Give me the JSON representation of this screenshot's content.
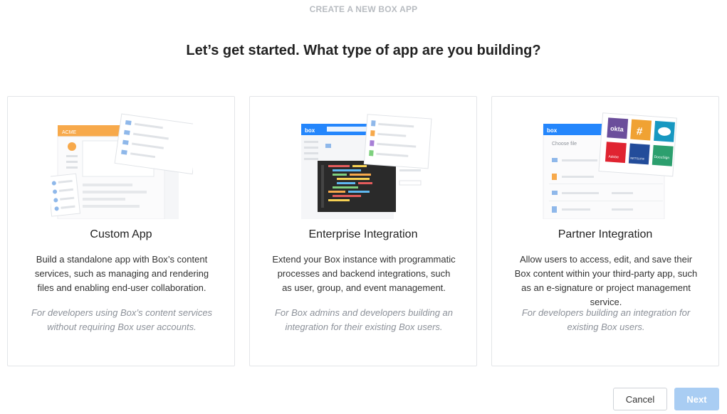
{
  "header": {
    "label": "CREATE A NEW BOX APP"
  },
  "page": {
    "title": "Let’s get started. What type of app are you building?"
  },
  "cards": [
    {
      "title": "Custom App",
      "description": "Build a standalone app with Box’s content services, such as managing and rendering files and enabling end-user collaboration.",
      "note": "For developers using Box’s content services without requiring Box user accounts.",
      "illustration_brand": "ACME"
    },
    {
      "title": "Enterprise Integration",
      "description": "Extend your Box instance with programmatic processes and backend integrations, such as user, group, and event management.",
      "note": "For Box admins and developers building an integration for their existing Box users.",
      "illustration_brand": "box"
    },
    {
      "title": "Partner Integration",
      "description": "Allow users to access, edit, and save their Box content within your third-party app, such as an e-signature or project management service.",
      "note": "For developers building an integration for existing Box users.",
      "illustration_brand": "box",
      "illustration_label": "Choose file",
      "partner_tiles": [
        "okta",
        "#",
        "",
        "Adobe",
        "NETSUITE",
        "DocuSign"
      ]
    }
  ],
  "buttons": {
    "cancel": "Cancel",
    "next": "Next"
  },
  "colors": {
    "accent": "#0061d5",
    "next_disabled": "#a9cdf3",
    "acme_orange": "#f7a94b",
    "box_blue": "#2486fc",
    "okta": "#6b4e9b",
    "slack": "#f0a233",
    "salesforce": "#1798c1",
    "adobe": "#e02431",
    "netsuite": "#234c9a",
    "docusign": "#2c9f6e"
  }
}
